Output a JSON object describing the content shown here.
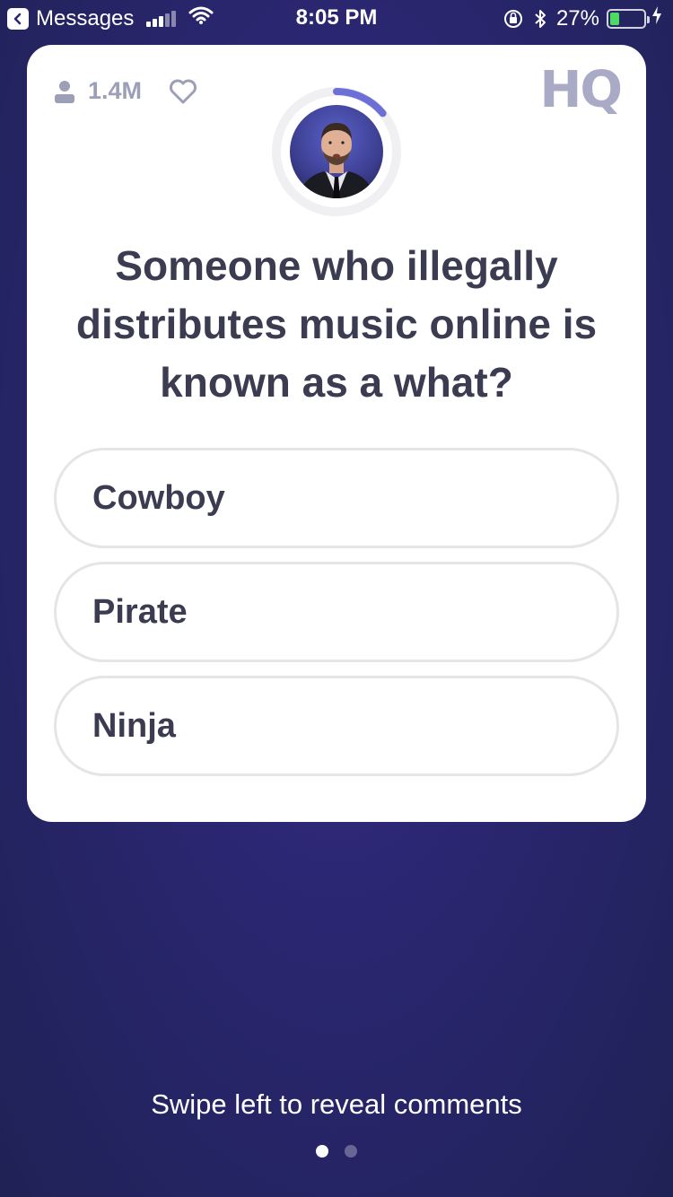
{
  "status_bar": {
    "back_app": "Messages",
    "time": "8:05 PM",
    "battery_percent": "27%",
    "battery_level": 0.27,
    "battery_color": "#4cd964"
  },
  "card": {
    "viewer_count": "1.4M",
    "logo": "HQ",
    "host_icon": "host-avatar",
    "timer_progress": 0.14,
    "timer_color": "#6c6fd6",
    "question": "Someone who illegally distributes music online is known as a what?",
    "answers": [
      "Cowboy",
      "Pirate",
      "Ninja"
    ]
  },
  "footer": {
    "hint": "Swipe left to reveal comments",
    "page_count": 2,
    "active_page": 0
  },
  "colors": {
    "background": "#2a2670",
    "card": "#ffffff",
    "question_text": "#3b3c52",
    "muted": "#9b9fb8",
    "answer_border": "#e5e5e8"
  }
}
